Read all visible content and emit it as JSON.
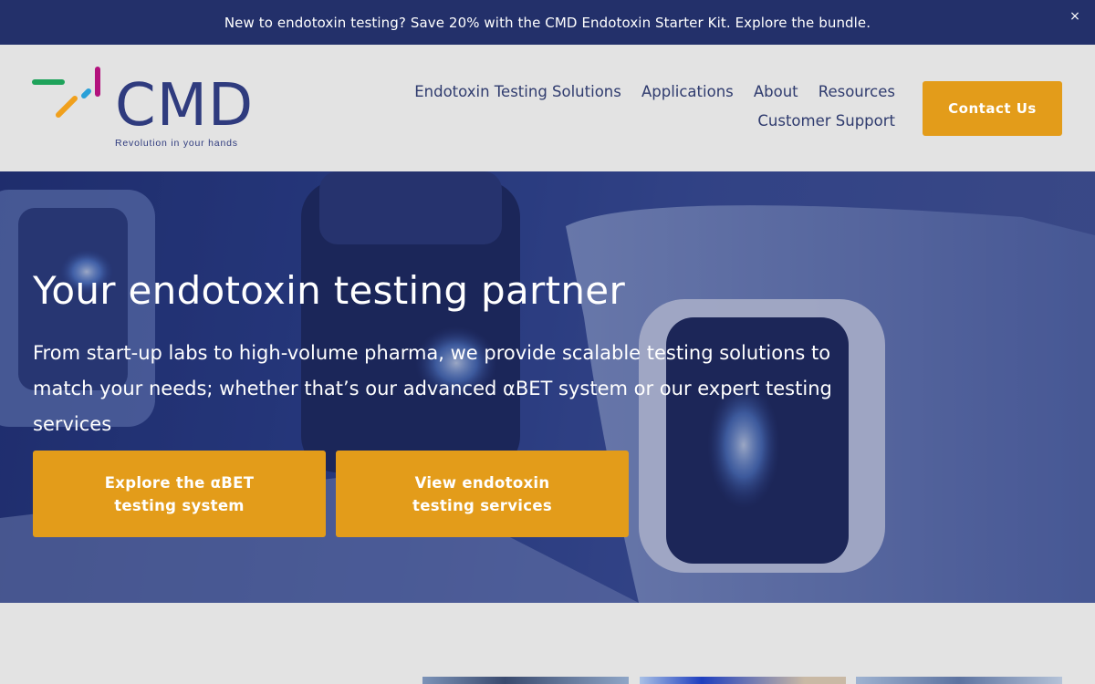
{
  "announcement": {
    "text": "New to endotoxin testing? Save 20% with the CMD Endotoxin Starter Kit. Explore the bundle.",
    "close_icon": "close-icon",
    "close_glyph": "×"
  },
  "header": {
    "logo": {
      "wordmark": "CMD",
      "tagline": "Revolution in your hands"
    },
    "nav": [
      {
        "label": "Endotoxin Testing Solutions"
      },
      {
        "label": "Applications"
      },
      {
        "label": "About"
      },
      {
        "label": "Resources"
      },
      {
        "label": "Customer Support"
      }
    ],
    "contact_label": "Contact Us"
  },
  "hero": {
    "title": "Your endotoxin testing partner",
    "subtitle": "From start-up labs to high-volume pharma, we provide scalable testing solutions to match your needs; whether that’s our advanced αBET system or our expert testing services",
    "buttons": [
      {
        "label": "Explore the αBET testing system"
      },
      {
        "label": "View endotoxin testing services"
      }
    ]
  },
  "colors": {
    "announcement_bg": "#23306a",
    "brand_navy": "#2f3b7e",
    "accent_orange": "#e39c1a",
    "page_bg": "#e3e3e3"
  }
}
